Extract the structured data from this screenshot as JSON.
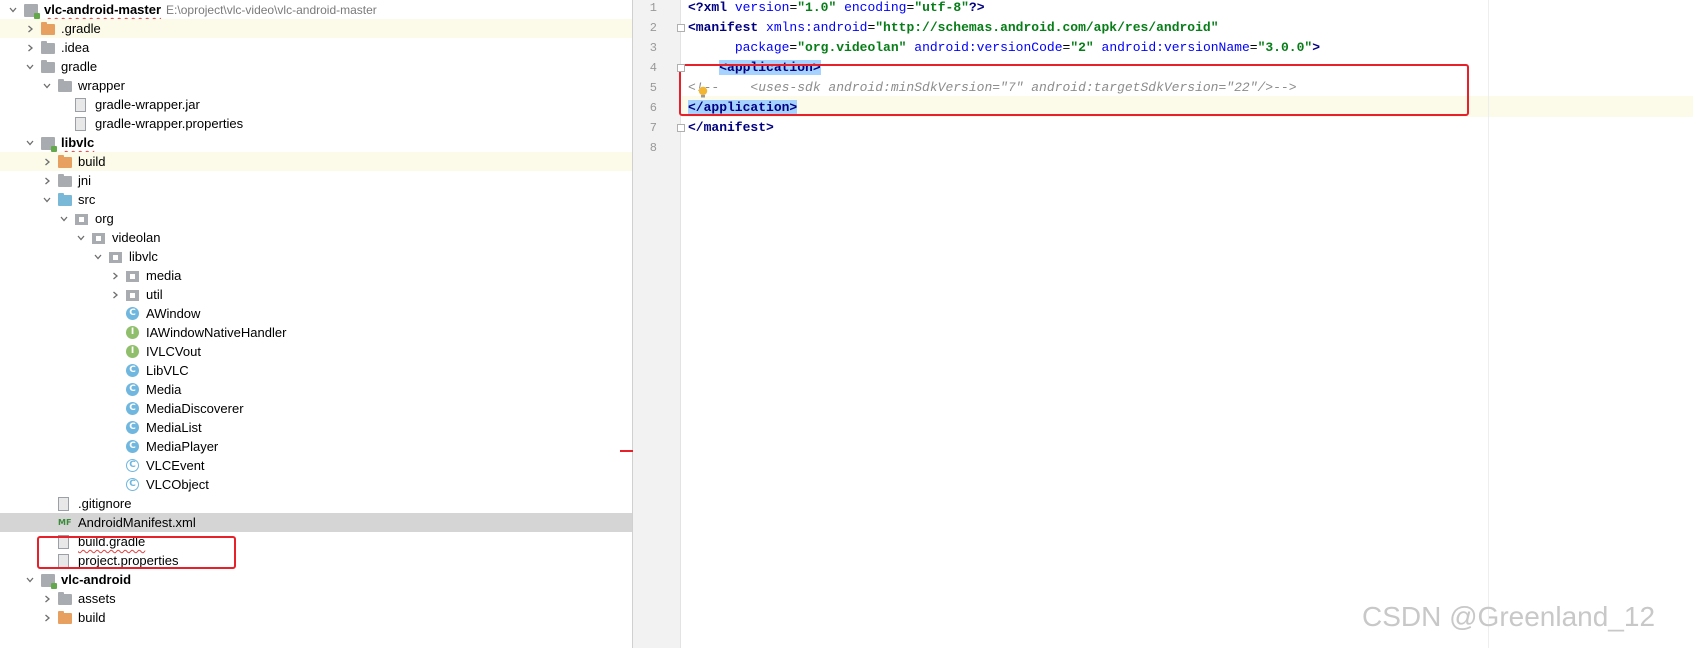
{
  "project_tree": {
    "rows": [
      {
        "label": "vlc-android-master",
        "path": "E:\\oproject\\vlc-video\\vlc-android-master",
        "depth": 0,
        "expanded": true,
        "icon": "module-icon",
        "bold": true
      },
      {
        "label": ".gradle",
        "depth": 1,
        "expanded": false,
        "icon": "folder-orange-icon"
      },
      {
        "label": ".idea",
        "depth": 1,
        "expanded": false,
        "icon": "folder-icon"
      },
      {
        "label": "gradle",
        "depth": 1,
        "expanded": true,
        "icon": "folder-icon"
      },
      {
        "label": "wrapper",
        "depth": 2,
        "expanded": true,
        "icon": "folder-icon"
      },
      {
        "label": "gradle-wrapper.jar",
        "depth": 3,
        "icon": "jar-file-icon"
      },
      {
        "label": "gradle-wrapper.properties",
        "depth": 3,
        "icon": "properties-file-icon"
      },
      {
        "label": "libvlc",
        "depth": 1,
        "expanded": true,
        "icon": "module-icon",
        "bold": true
      },
      {
        "label": "build",
        "depth": 2,
        "expanded": false,
        "icon": "folder-orange-icon"
      },
      {
        "label": "jni",
        "depth": 2,
        "expanded": false,
        "icon": "folder-icon"
      },
      {
        "label": "src",
        "depth": 2,
        "expanded": true,
        "icon": "folder-blue-icon"
      },
      {
        "label": "org",
        "depth": 3,
        "expanded": true,
        "icon": "package-icon"
      },
      {
        "label": "videolan",
        "depth": 4,
        "expanded": true,
        "icon": "package-icon"
      },
      {
        "label": "libvlc",
        "depth": 5,
        "expanded": true,
        "icon": "package-icon"
      },
      {
        "label": "media",
        "depth": 6,
        "expanded": false,
        "icon": "package-icon"
      },
      {
        "label": "util",
        "depth": 6,
        "expanded": false,
        "icon": "package-icon"
      },
      {
        "label": "AWindow",
        "depth": 6,
        "icon": "class-icon",
        "glyph": "C"
      },
      {
        "label": "IAWindowNativeHandler",
        "depth": 6,
        "icon": "interface-icon",
        "glyph": "I"
      },
      {
        "label": "IVLCVout",
        "depth": 6,
        "icon": "interface-icon",
        "glyph": "I"
      },
      {
        "label": "LibVLC",
        "depth": 6,
        "icon": "class-icon",
        "glyph": "C"
      },
      {
        "label": "Media",
        "depth": 6,
        "icon": "class-icon",
        "glyph": "C"
      },
      {
        "label": "MediaDiscoverer",
        "depth": 6,
        "icon": "class-icon",
        "glyph": "C"
      },
      {
        "label": "MediaList",
        "depth": 6,
        "icon": "class-icon",
        "glyph": "C"
      },
      {
        "label": "MediaPlayer",
        "depth": 6,
        "icon": "class-icon",
        "glyph": "C"
      },
      {
        "label": "VLCEvent",
        "depth": 6,
        "icon": "abstract-class-icon",
        "glyph": "C"
      },
      {
        "label": "VLCObject",
        "depth": 6,
        "icon": "abstract-class-icon",
        "glyph": "C"
      },
      {
        "label": ".gitignore",
        "depth": 2,
        "icon": "gitignore-file-icon"
      },
      {
        "label": "AndroidManifest.xml",
        "depth": 2,
        "icon": "manifest-file-icon",
        "glyph": "MF"
      },
      {
        "label": "build.gradle",
        "depth": 2,
        "icon": "gradle-file-icon"
      },
      {
        "label": "project.properties",
        "depth": 2,
        "icon": "properties-file-icon"
      },
      {
        "label": "vlc-android",
        "depth": 1,
        "expanded": true,
        "icon": "module-icon",
        "bold": true
      },
      {
        "label": "assets",
        "depth": 2,
        "expanded": false,
        "icon": "folder-icon"
      },
      {
        "label": "build",
        "depth": 2,
        "expanded": false,
        "icon": "folder-orange-icon"
      }
    ]
  },
  "editor": {
    "line_numbers": [
      "1",
      "2",
      "3",
      "4",
      "5",
      "6",
      "7",
      "8"
    ],
    "lines": [
      [
        {
          "t": "<?",
          "c": "tag"
        },
        {
          "t": "xml ",
          "c": "tag"
        },
        {
          "t": "version",
          "c": "attr"
        },
        {
          "t": "=",
          "c": ""
        },
        {
          "t": "\"1.0\"",
          "c": "val"
        },
        {
          "t": " ",
          "c": ""
        },
        {
          "t": "encoding",
          "c": "attr"
        },
        {
          "t": "=",
          "c": ""
        },
        {
          "t": "\"utf-8\"",
          "c": "val"
        },
        {
          "t": "?>",
          "c": "tag"
        }
      ],
      [
        {
          "t": "<manifest ",
          "c": "tag"
        },
        {
          "t": "xmlns:android",
          "c": "attr"
        },
        {
          "t": "=",
          "c": ""
        },
        {
          "t": "\"http://schemas.android.com/apk/res/android\"",
          "c": "val"
        }
      ],
      [
        {
          "t": "      ",
          "c": ""
        },
        {
          "t": "package",
          "c": "attr"
        },
        {
          "t": "=",
          "c": ""
        },
        {
          "t": "\"org.videolan\"",
          "c": "val"
        },
        {
          "t": " ",
          "c": ""
        },
        {
          "t": "android:versionCode",
          "c": "attr"
        },
        {
          "t": "=",
          "c": ""
        },
        {
          "t": "\"2\"",
          "c": "val"
        },
        {
          "t": " ",
          "c": ""
        },
        {
          "t": "android:versionName",
          "c": "attr"
        },
        {
          "t": "=",
          "c": ""
        },
        {
          "t": "\"3.0.0\"",
          "c": "val"
        },
        {
          "t": ">",
          "c": "tag"
        }
      ],
      [
        {
          "t": "    ",
          "c": ""
        },
        {
          "t": "<application>",
          "c": "tag sel-bg"
        }
      ],
      [
        {
          "t": "<!--    <uses-sdk android:minSdkVersion=\"7\" android:targetSdkVersion=\"22\"/>-->",
          "c": "cmt"
        }
      ],
      [
        {
          "t": "</application>",
          "c": "tag sel-bg"
        }
      ],
      [
        {
          "t": "</manifest>",
          "c": "tag"
        }
      ],
      []
    ]
  },
  "watermark": "CSDN @Greenland_12"
}
